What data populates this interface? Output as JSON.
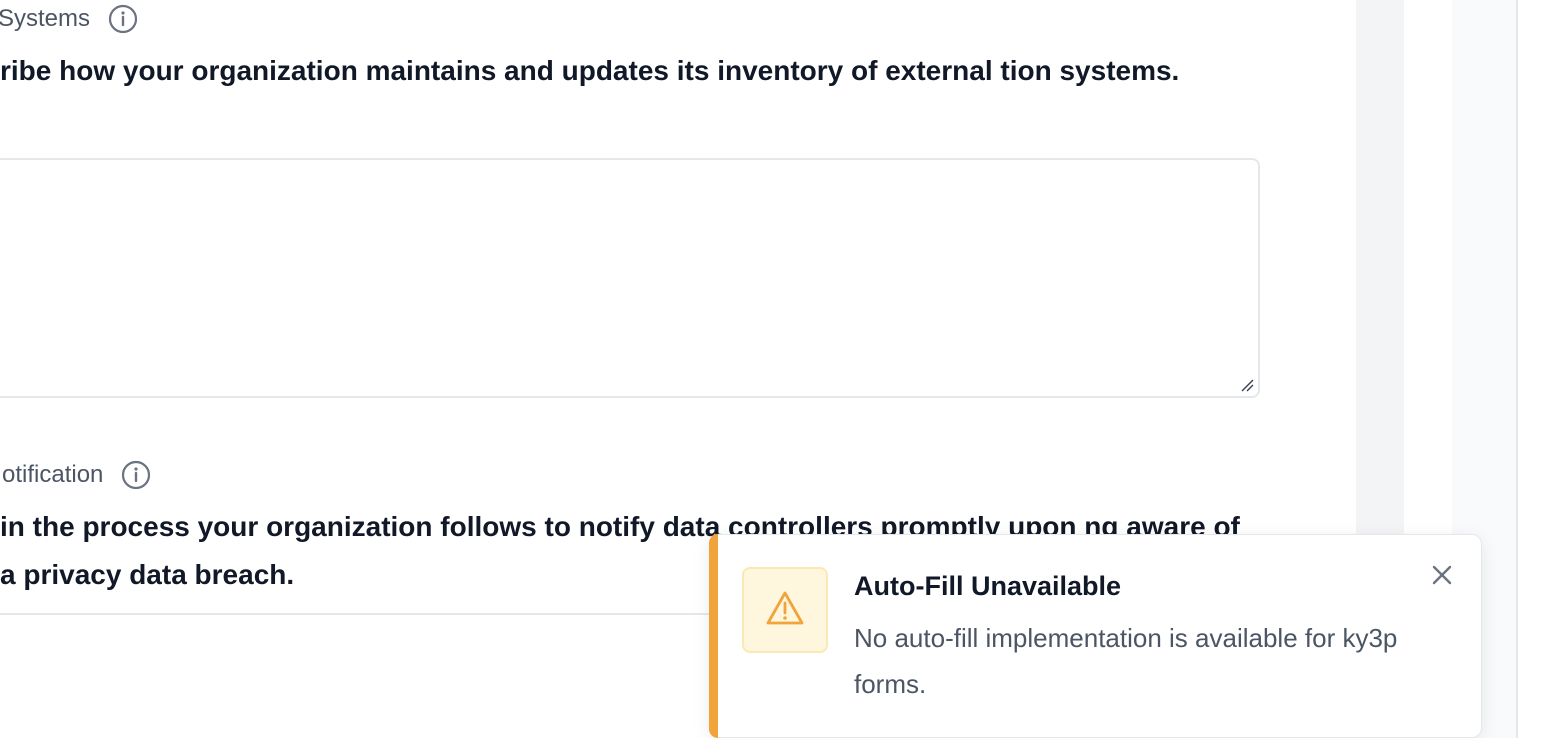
{
  "sections": [
    {
      "label": "Systems",
      "question": "ribe how your organization maintains and updates its inventory of external tion systems.",
      "answer_value": ""
    },
    {
      "label": "otification",
      "question": "in the process your organization follows to notify data controllers promptly upon ng aware of a privacy data breach."
    }
  ],
  "toast": {
    "title": "Auto-Fill Unavailable",
    "message": "No auto-fill implementation is available for ky3p forms.",
    "accent_color": "#f0a43b",
    "icon": "warning-icon"
  }
}
